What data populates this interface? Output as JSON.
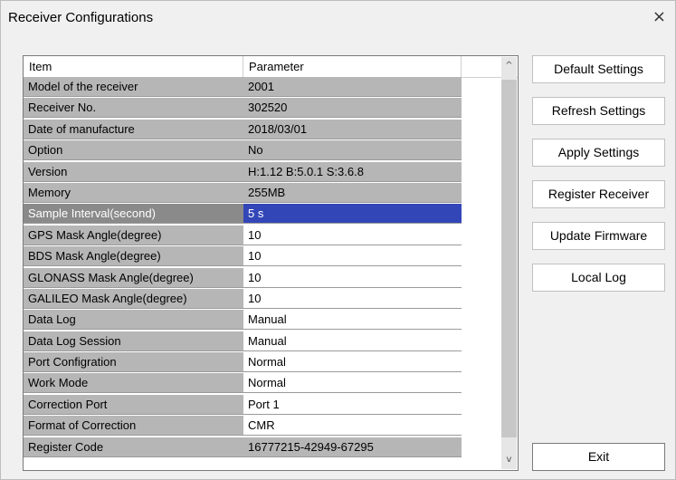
{
  "window": {
    "title": "Receiver Configurations",
    "close_glyph": "×"
  },
  "table": {
    "headers": [
      "Item",
      "Parameter",
      ""
    ],
    "rows": [
      {
        "item": "Model of the receiver",
        "param": "2001"
      },
      {
        "item": "Receiver No.",
        "param": "302520"
      },
      {
        "item": "Date of manufacture",
        "param": "2018/03/01"
      },
      {
        "item": "Option",
        "param": "No"
      },
      {
        "item": "Version",
        "param": "H:1.12 B:5.0.1 S:3.6.8"
      },
      {
        "item": "Memory",
        "param": "255MB"
      },
      {
        "item": "Sample Interval(second)",
        "param": "5 s"
      },
      {
        "item": "GPS Mask Angle(degree)",
        "param": "10"
      },
      {
        "item": "BDS Mask Angle(degree)",
        "param": "10"
      },
      {
        "item": "GLONASS Mask Angle(degree)",
        "param": "10"
      },
      {
        "item": "GALILEO Mask Angle(degree)",
        "param": "10"
      },
      {
        "item": "Data Log",
        "param": "Manual"
      },
      {
        "item": "Data Log Session",
        "param": "Manual"
      },
      {
        "item": "Port Configration",
        "param": "Normal"
      },
      {
        "item": "Work Mode",
        "param": "Normal"
      },
      {
        "item": "Correction Port",
        "param": "Port 1"
      },
      {
        "item": "Format of Correction",
        "param": "CMR"
      },
      {
        "item": "Register Code",
        "param": "16777215-42949-67295"
      }
    ]
  },
  "scroll": {
    "up_glyph": "^",
    "down_glyph": "v"
  },
  "buttons": {
    "default": "Default Settings",
    "refresh": "Refresh Settings",
    "apply": "Apply Settings",
    "register": "Register Receiver",
    "update": "Update Firmware",
    "local_log": "Local Log",
    "exit": "Exit"
  }
}
